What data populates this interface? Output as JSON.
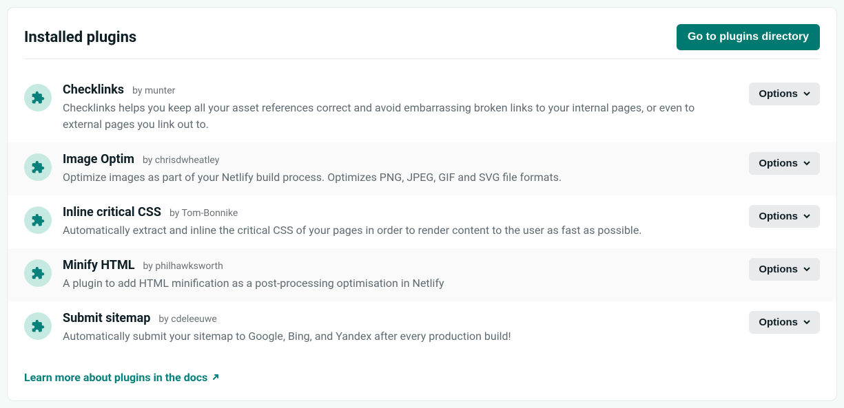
{
  "header": {
    "title": "Installed plugins",
    "primary_button": "Go to plugins directory"
  },
  "options_label": "Options",
  "plugins": [
    {
      "name": "Checklinks",
      "by_label": "by munter",
      "description": "Checklinks helps you keep all your asset references correct and avoid embarrassing broken links to your internal pages, or even to external pages you link out to."
    },
    {
      "name": "Image Optim",
      "by_label": "by chrisdwheatley",
      "description": "Optimize images as part of your Netlify build process. Optimizes PNG, JPEG, GIF and SVG file formats."
    },
    {
      "name": "Inline critical CSS",
      "by_label": "by Tom-Bonnike",
      "description": "Automatically extract and inline the critical CSS of your pages in order to render content to the user as fast as possible."
    },
    {
      "name": "Minify HTML",
      "by_label": "by philhawksworth",
      "description": "A plugin to add HTML minification as a post-processing optimisation in Netlify"
    },
    {
      "name": "Submit sitemap",
      "by_label": "by cdeleeuwe",
      "description": "Automatically submit your sitemap to Google, Bing, and Yandex after every production build!"
    }
  ],
  "footer": {
    "link_text": "Learn more about plugins in the docs"
  }
}
